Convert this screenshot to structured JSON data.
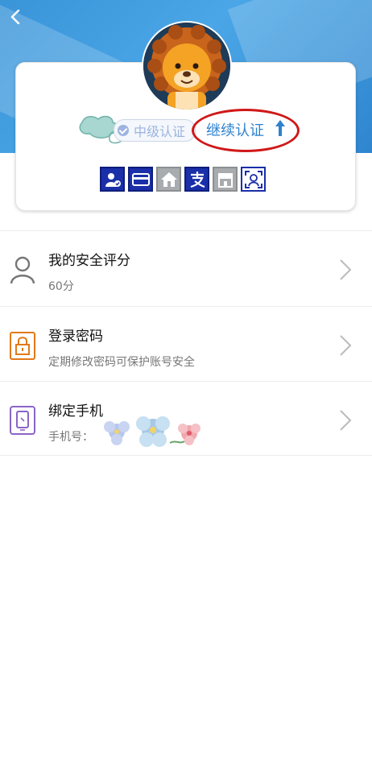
{
  "header": {
    "back_label": "back"
  },
  "profile": {
    "level_label": "中级认证",
    "continue_label": "继续认证"
  },
  "auth_icons": [
    "id-user-check-icon",
    "bank-card-icon",
    "house-icon",
    "alipay-zhi-icon",
    "store-icon",
    "face-scan-icon"
  ],
  "settings": [
    {
      "title": "我的安全评分",
      "subtitle": "60分"
    },
    {
      "title": "登录密码",
      "subtitle": "定期修改密码可保护账号安全"
    },
    {
      "title": "绑定手机",
      "subtitle": "手机号："
    }
  ],
  "colors": {
    "header_blue": "#3a94d8",
    "accent_blue": "#2d82d0",
    "annotation_red": "#d01818",
    "password_orange": "#e07a1a",
    "phone_purple": "#8a64c8"
  }
}
